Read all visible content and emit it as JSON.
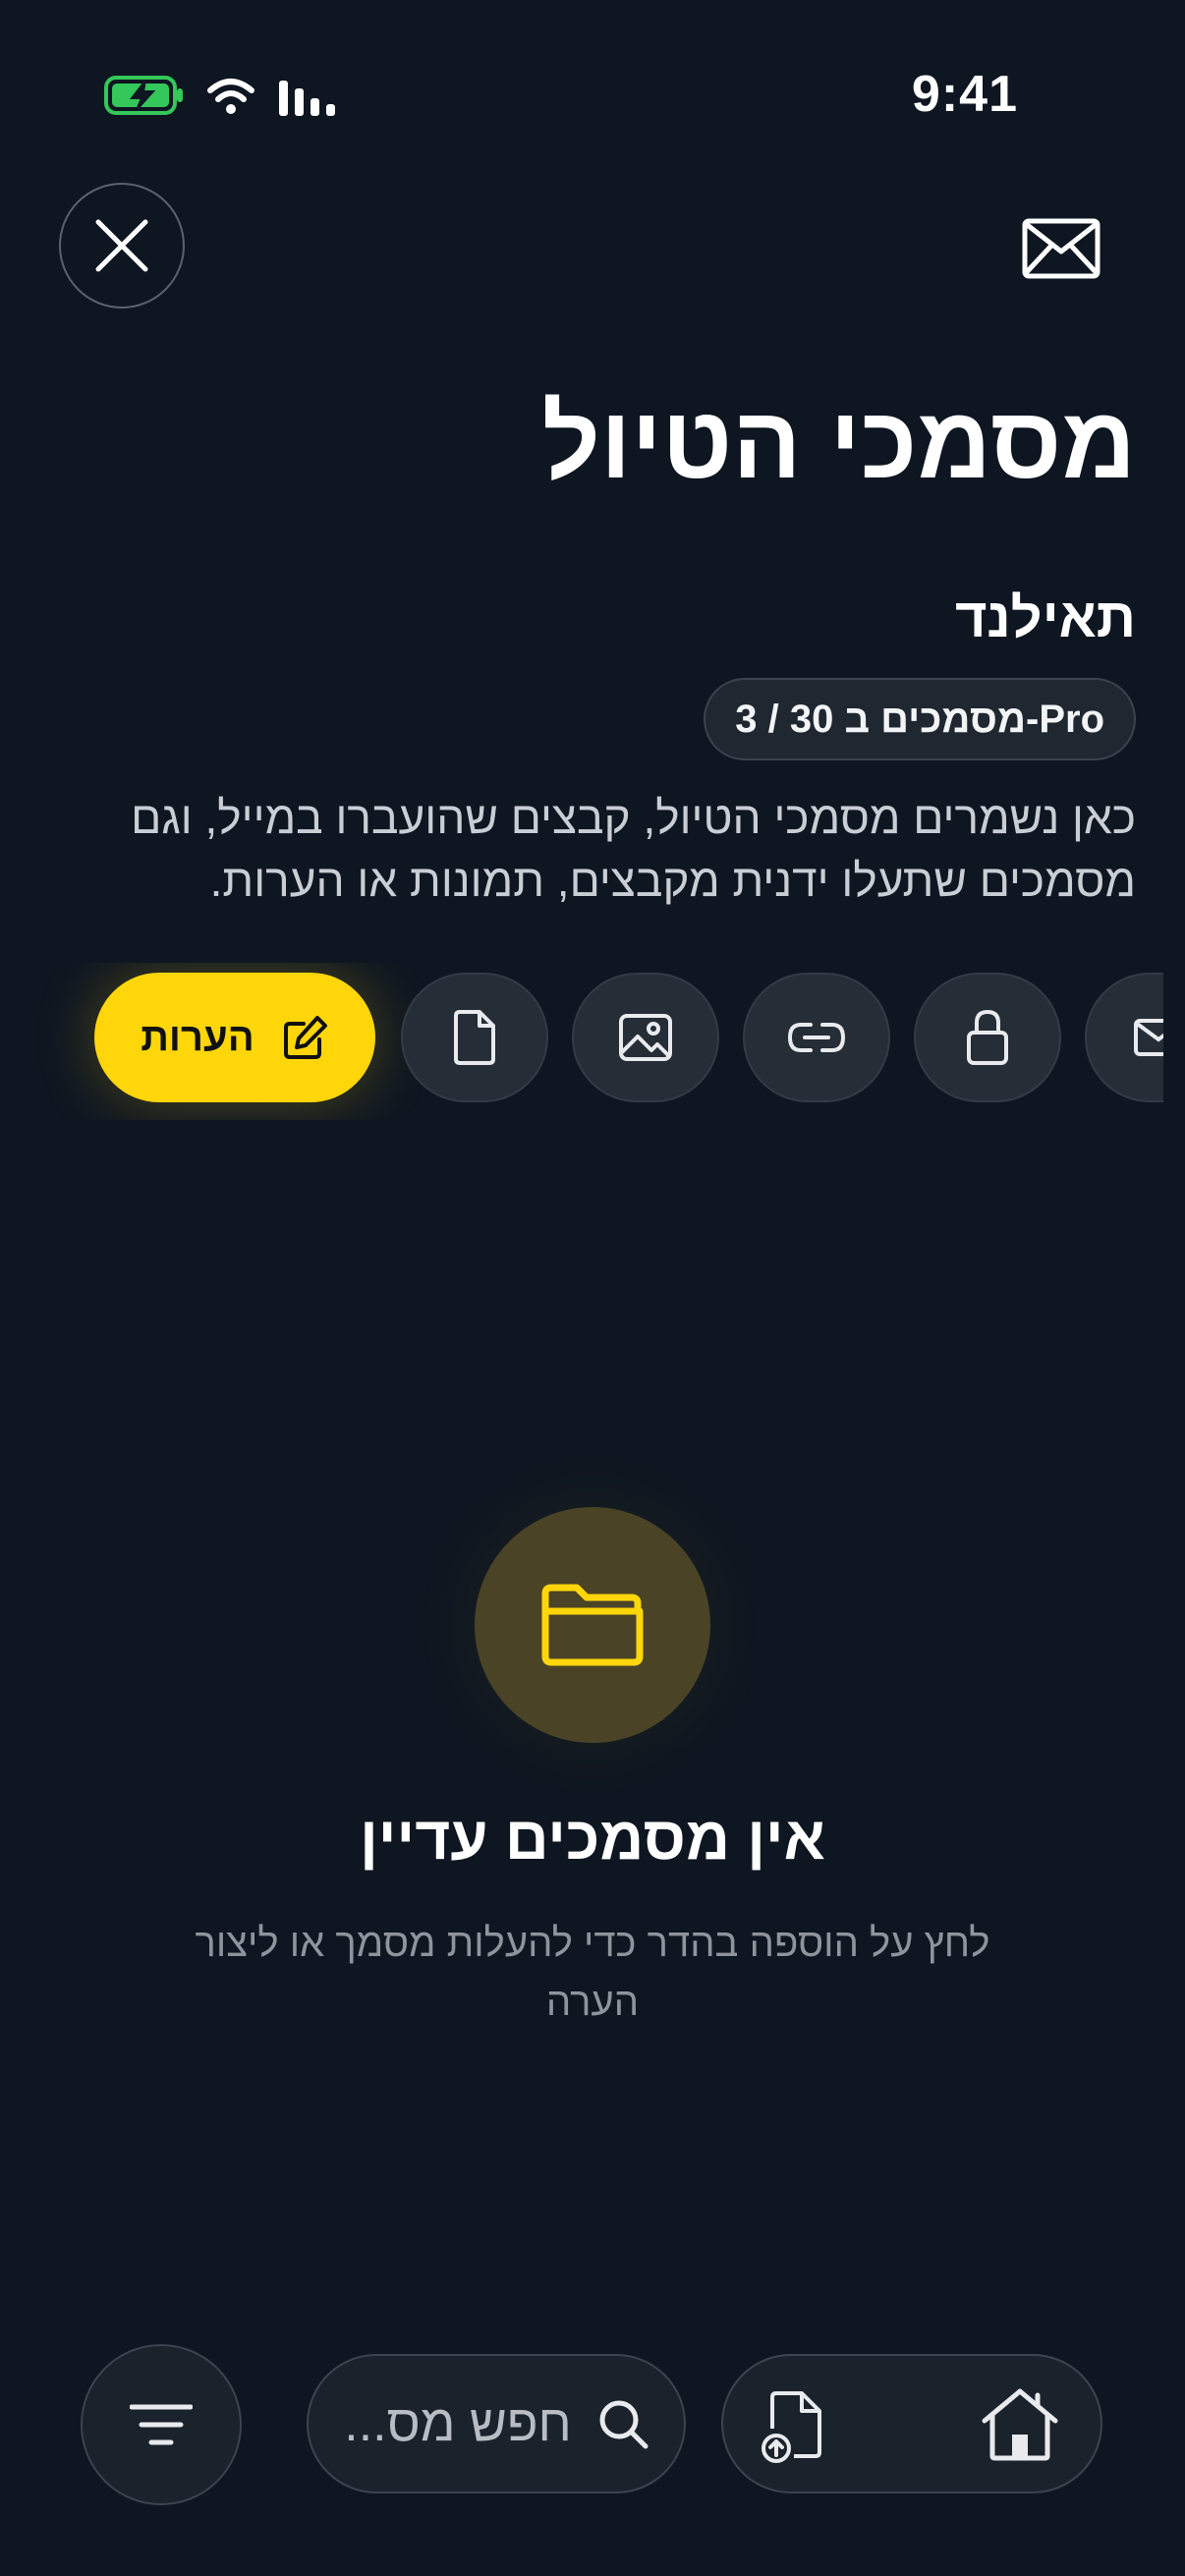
{
  "status_bar": {
    "time": "9:41",
    "icons": [
      "battery-charging-icon",
      "wifi-icon",
      "signal-icon"
    ],
    "battery_color": "#34c759"
  },
  "header": {
    "close_icon": "close-icon",
    "mail_icon": "mail-icon"
  },
  "page": {
    "title": "מסמכי הטיול",
    "trip_name": "תאילנד",
    "quota_badge": "3 / 30 מסמכים ב-Pro",
    "description": "כאן נשמרים מסמכי הטיול, קבצים שהועברו במייל, וגם מסמכים שתעלו ידנית מקבצים, תמונות או הערות."
  },
  "filters": {
    "active": {
      "label": "הערות",
      "icon": "edit-note-icon"
    },
    "chips": [
      {
        "icon": "file-icon"
      },
      {
        "icon": "image-icon"
      },
      {
        "icon": "link-icon"
      },
      {
        "icon": "lock-icon"
      },
      {
        "icon": "mail-icon"
      }
    ],
    "accent": "#ffd60a"
  },
  "empty_state": {
    "icon": "folder-open-icon",
    "title": "אין מסמכים עדיין",
    "subtitle": "לחץ על הוספה בהדר כדי להעלות מסמך או ליצור הערה"
  },
  "bottom_bar": {
    "menu_icon": "filter-menu-icon",
    "search_placeholder": "חפש מס...",
    "search_icon": "search-icon",
    "nav_icons": [
      "home-icon",
      "upload-file-icon"
    ]
  }
}
